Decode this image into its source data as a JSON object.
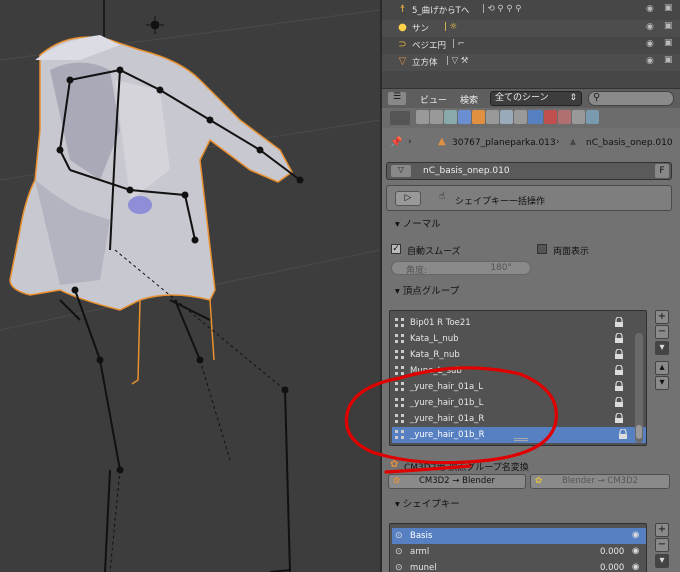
{
  "outliner": {
    "rows": [
      {
        "label": "5_曲げからTへ",
        "icon": "armature-icon",
        "extra": "| ⟲ ⚲ ⚲ ⚲"
      },
      {
        "label": "サン",
        "icon": "sun-lamp-icon",
        "extra": "| ☼"
      },
      {
        "label": "ベジエ円",
        "icon": "curve-icon",
        "extra": "| ⌐"
      },
      {
        "label": "立方体",
        "icon": "mesh-icon",
        "extra": "| ▽ ⚒"
      }
    ]
  },
  "outliner_bar": {
    "view": "ビュー",
    "search": "検索",
    "scene_select": "全てのシーン"
  },
  "context": {
    "object": "30767_planeparka.013",
    "mesh": "nC_basis_onep.010"
  },
  "datablock": {
    "name": "nC_basis_onep.010",
    "fake_user": "F"
  },
  "shapekey_batch": {
    "label": "シェイプキー一括操作"
  },
  "normals": {
    "title": "ノーマル",
    "auto_smooth": "自動スムーズ",
    "double_sided": "両面表示",
    "angle_label": "角度:",
    "angle_value": "180°"
  },
  "vertex_groups": {
    "title": "頂点グループ",
    "items": [
      "Bip01 R Toe21",
      "Kata_L_nub",
      "Kata_R_nub",
      "Mune_L_sub",
      "_yure_hair_01a_L",
      "_yure_hair_01b_L",
      "_yure_hair_01a_R",
      "_yure_hair_01b_R"
    ],
    "selected_index": 7
  },
  "cm3d2": {
    "title": "CM3D2用 頂点グループ名変換",
    "btn_to_blender": "CM3D2 → Blender",
    "btn_to_cm3d2": "Blender → CM3D2"
  },
  "shape_keys": {
    "title": "シェイプキー",
    "items": [
      {
        "name": "Basis",
        "value": ""
      },
      {
        "name": "arml",
        "value": "0.000"
      },
      {
        "name": "munel",
        "value": "0.000"
      }
    ]
  },
  "colors": {
    "selection_blue": "#5680c2",
    "annotation_red": "#e00000",
    "selected_outline": "#e89030"
  }
}
